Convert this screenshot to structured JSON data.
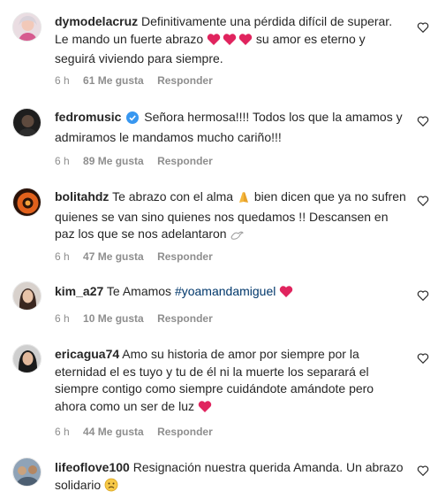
{
  "colors": {
    "accent_link": "#00376b",
    "meta_gray": "#8e8e8e",
    "heart_red": "#e0245e",
    "verified_blue": "#3897f0"
  },
  "comments": [
    {
      "username": "dymodelacruz",
      "text1": "Definitivamente una pérdida difícil de superar. Le mando un fuerte abrazo",
      "text2": "su amor es eterno y seguirá viviendo para siempre.",
      "time": "6 h",
      "likes": "61 Me gusta",
      "reply": "Responder"
    },
    {
      "username": "fedromusic",
      "text1": "Señora hermosa!!!! Todos los que la amamos y admiramos le mandamos mucho cariño!!!",
      "time": "6 h",
      "likes": "89 Me gusta",
      "reply": "Responder"
    },
    {
      "username": "bolitahdz",
      "text1": "Te abrazo con el alma",
      "text2": "bien dicen que ya no sufren quienes se van sino quienes nos quedamos !! Descansen en paz los que se nos adelantaron",
      "time": "6 h",
      "likes": "47 Me gusta",
      "reply": "Responder"
    },
    {
      "username": "kim_a27",
      "text1": "Te Amamos",
      "hashtag": "#yoamandamiguel",
      "time": "6 h",
      "likes": "10 Me gusta",
      "reply": "Responder"
    },
    {
      "username": "ericagua74",
      "text1": "Amo su historia de amor por siempre por la eternidad el es tuyo y tu de él ni la muerte los separará el siempre contigo como siempre cuidándote amándote pero ahora como un ser de luz",
      "time": "6 h",
      "likes": "44 Me gusta",
      "reply": "Responder"
    },
    {
      "username": "lifeoflove100",
      "text1": "Resignación nuestra querida Amanda. Un abrazo solidario"
    }
  ]
}
